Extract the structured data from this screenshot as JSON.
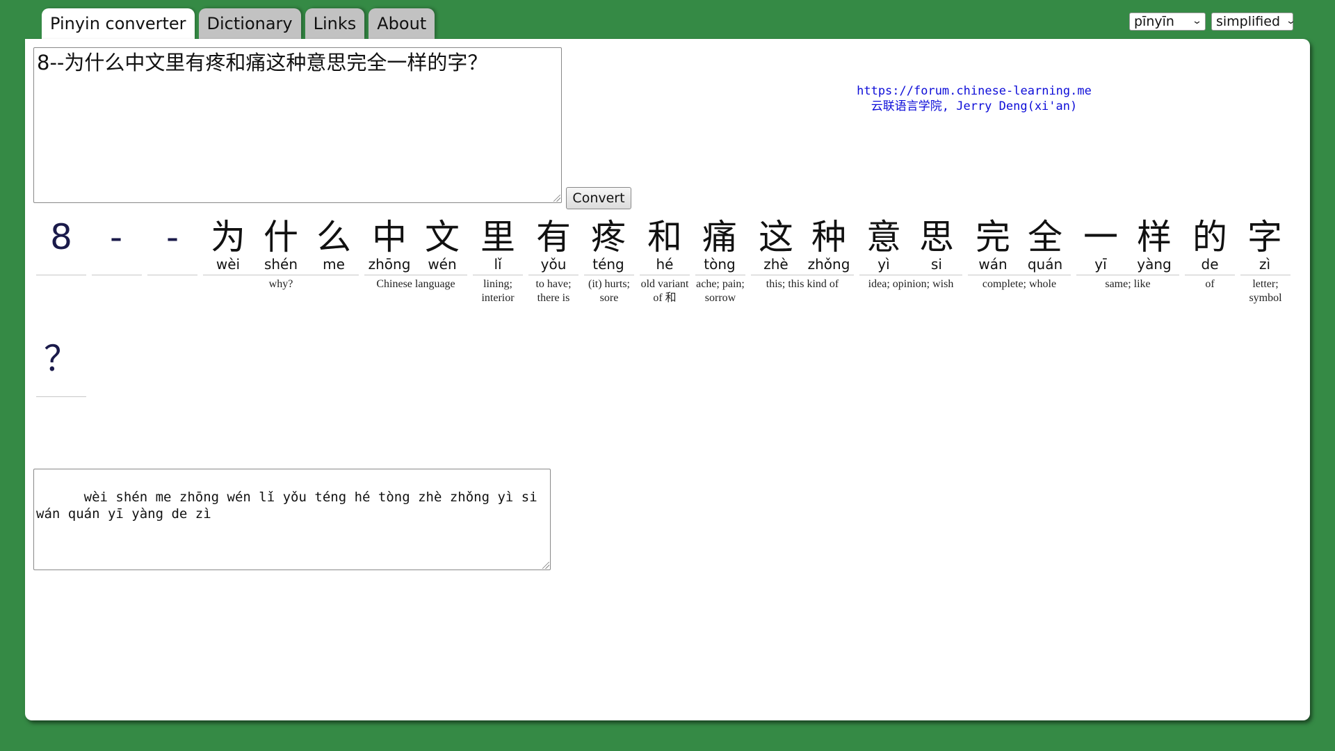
{
  "tabs": [
    {
      "label": "Pinyin converter",
      "active": true
    },
    {
      "label": "Dictionary",
      "active": false
    },
    {
      "label": "Links",
      "active": false
    },
    {
      "label": "About",
      "active": false
    }
  ],
  "selects": {
    "mode": "pīnyīn",
    "script": "simplified"
  },
  "input": {
    "value": "8--为什么中文里有疼和痛这种意思完全一样的字？"
  },
  "convert_label": "Convert",
  "credit": {
    "url": "https://forum.chinese-learning.me",
    "name": "云联语言学院, Jerry Deng(xi'an)"
  },
  "chars": [
    {
      "c": "8",
      "p": ""
    },
    {
      "c": "-",
      "p": ""
    },
    {
      "c": "-",
      "p": ""
    },
    {
      "c": "为",
      "p": "wèi"
    },
    {
      "c": "什",
      "p": "shén"
    },
    {
      "c": "么",
      "p": "me"
    },
    {
      "c": "中",
      "p": "zhōng"
    },
    {
      "c": "文",
      "p": "wén"
    },
    {
      "c": "里",
      "p": "lǐ"
    },
    {
      "c": "有",
      "p": "yǒu"
    },
    {
      "c": "疼",
      "p": "téng"
    },
    {
      "c": "和",
      "p": "hé"
    },
    {
      "c": "痛",
      "p": "tòng"
    },
    {
      "c": "这",
      "p": "zhè"
    },
    {
      "c": "种",
      "p": "zhǒng"
    },
    {
      "c": "意",
      "p": "yì"
    },
    {
      "c": "思",
      "p": "si"
    },
    {
      "c": "完",
      "p": "wán"
    },
    {
      "c": "全",
      "p": "quán"
    },
    {
      "c": "一",
      "p": "yī"
    },
    {
      "c": "样",
      "p": "yàng"
    },
    {
      "c": "的",
      "p": "de"
    },
    {
      "c": "字",
      "p": "zì"
    },
    {
      "c": "？",
      "p": ""
    }
  ],
  "glosses": [
    "why?",
    "Chinese language",
    "lining; interior",
    "to have; there is",
    "(it) hurts; sore",
    "old variant of 和",
    "ache; pain; sorrow",
    "this; this kind of",
    "idea; opinion; wish",
    "complete; whole",
    "same; like",
    "of",
    "letter; symbol"
  ],
  "output": {
    "value": "  wèi shén me zhōng wén lǐ yǒu téng hé tòng zhè zhǒng yì si wán quán yī yàng de zì"
  }
}
